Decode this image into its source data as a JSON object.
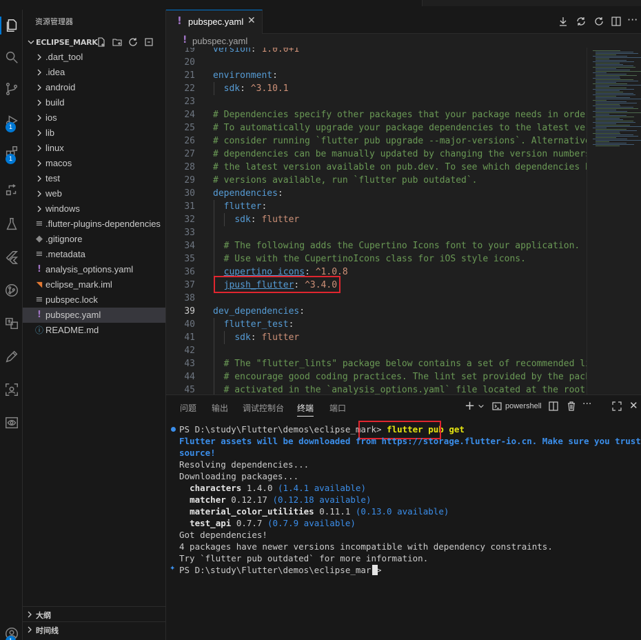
{
  "explorer": {
    "title": "资源管理器",
    "folder": "ECLIPSE_MARK",
    "items": [
      {
        "label": ".dart_tool",
        "kind": "folder"
      },
      {
        "label": ".idea",
        "kind": "folder"
      },
      {
        "label": "android",
        "kind": "folder"
      },
      {
        "label": "build",
        "kind": "folder"
      },
      {
        "label": "ios",
        "kind": "folder"
      },
      {
        "label": "lib",
        "kind": "folder"
      },
      {
        "label": "linux",
        "kind": "folder"
      },
      {
        "label": "macos",
        "kind": "folder"
      },
      {
        "label": "test",
        "kind": "folder"
      },
      {
        "label": "web",
        "kind": "folder"
      },
      {
        "label": "windows",
        "kind": "folder"
      },
      {
        "label": ".flutter-plugins-dependencies",
        "kind": "lines"
      },
      {
        "label": ".gitignore",
        "kind": "git"
      },
      {
        "label": ".metadata",
        "kind": "lines"
      },
      {
        "label": "analysis_options.yaml",
        "kind": "yaml"
      },
      {
        "label": "eclipse_mark.iml",
        "kind": "rss"
      },
      {
        "label": "pubspec.lock",
        "kind": "lines"
      },
      {
        "label": "pubspec.yaml",
        "kind": "yaml"
      },
      {
        "label": "README.md",
        "kind": "info"
      }
    ],
    "outline_label": "大纲",
    "timeline_label": "时间线"
  },
  "activity": {
    "badges": [
      "1",
      "1"
    ]
  },
  "editor": {
    "tab_label": "pubspec.yaml",
    "breadcrumb": "pubspec.yaml",
    "lines": [
      {
        "n": "19",
        "t": [
          [
            "k",
            "version"
          ],
          [
            "p",
            ": "
          ],
          [
            "s",
            "1.0.0+1"
          ]
        ]
      },
      {
        "n": "20",
        "t": []
      },
      {
        "n": "21",
        "t": [
          [
            "k",
            "environment"
          ],
          [
            "p",
            ":"
          ]
        ]
      },
      {
        "n": "22",
        "t": [
          [
            "p",
            "  "
          ],
          [
            "k",
            "sdk"
          ],
          [
            "p",
            ": "
          ],
          [
            "s",
            "^3.10.1"
          ]
        ]
      },
      {
        "n": "23",
        "t": []
      },
      {
        "n": "24",
        "t": [
          [
            "c",
            "# Dependencies specify other packages that your package needs in order to work."
          ]
        ]
      },
      {
        "n": "25",
        "t": [
          [
            "c",
            "# To automatically upgrade your package dependencies to the latest versions"
          ]
        ]
      },
      {
        "n": "26",
        "t": [
          [
            "c",
            "# consider running `flutter pub upgrade --major-versions`. Alternatively,"
          ]
        ]
      },
      {
        "n": "27",
        "t": [
          [
            "c",
            "# dependencies can be manually updated by changing the version numbers below to"
          ]
        ]
      },
      {
        "n": "28",
        "t": [
          [
            "c",
            "# the latest version available on pub.dev. To see which dependencies have newer"
          ]
        ]
      },
      {
        "n": "29",
        "t": [
          [
            "c",
            "# versions available, run `flutter pub outdated`."
          ]
        ]
      },
      {
        "n": "30",
        "t": [
          [
            "k",
            "dependencies"
          ],
          [
            "p",
            ":"
          ]
        ]
      },
      {
        "n": "31",
        "t": [
          [
            "p",
            "  "
          ],
          [
            "k",
            "flutter"
          ],
          [
            "p",
            ":"
          ]
        ]
      },
      {
        "n": "32",
        "t": [
          [
            "p",
            "    "
          ],
          [
            "k",
            "sdk"
          ],
          [
            "p",
            ": "
          ],
          [
            "s",
            "flutter"
          ]
        ]
      },
      {
        "n": "33",
        "t": []
      },
      {
        "n": "34",
        "t": [
          [
            "p",
            "  "
          ],
          [
            "c",
            "# The following adds the Cupertino Icons font to your application."
          ]
        ]
      },
      {
        "n": "35",
        "t": [
          [
            "p",
            "  "
          ],
          [
            "c",
            "# Use with the CupertinoIcons class for iOS style icons."
          ]
        ]
      },
      {
        "n": "36",
        "t": [
          [
            "p",
            "  "
          ],
          [
            "ku",
            "cupertino_icons"
          ],
          [
            "p",
            ": "
          ],
          [
            "s",
            "^1.0.8"
          ]
        ]
      },
      {
        "n": "37",
        "t": [
          [
            "p",
            "  "
          ],
          [
            "ku",
            "jpush_flutter"
          ],
          [
            "p",
            ": "
          ],
          [
            "s",
            "^3.4.0"
          ]
        ]
      },
      {
        "n": "38",
        "t": []
      },
      {
        "n": "39",
        "t": [
          [
            "k",
            "dev_dependencies"
          ],
          [
            "p",
            ":"
          ]
        ]
      },
      {
        "n": "40",
        "t": [
          [
            "p",
            "  "
          ],
          [
            "k",
            "flutter_test"
          ],
          [
            "p",
            ":"
          ]
        ]
      },
      {
        "n": "41",
        "t": [
          [
            "p",
            "    "
          ],
          [
            "k",
            "sdk"
          ],
          [
            "p",
            ": "
          ],
          [
            "s",
            "flutter"
          ]
        ]
      },
      {
        "n": "42",
        "t": []
      },
      {
        "n": "43",
        "t": [
          [
            "p",
            "  "
          ],
          [
            "c",
            "# The \"flutter_lints\" package below contains a set of recommended lints to"
          ]
        ]
      },
      {
        "n": "44",
        "t": [
          [
            "p",
            "  "
          ],
          [
            "c",
            "# encourage good coding practices. The lint set provided by the package is"
          ]
        ]
      },
      {
        "n": "45",
        "t": [
          [
            "p",
            "  "
          ],
          [
            "c",
            "# activated in the `analysis_options.yaml` file located at the root of your"
          ]
        ]
      }
    ],
    "current_line": "39"
  },
  "panel": {
    "tabs": [
      "问题",
      "输出",
      "调试控制台",
      "终端",
      "端口"
    ],
    "active_tab": "终端",
    "shell_label": "powershell",
    "terminal": {
      "prompt1": "PS D:\\study\\Flutter\\demos\\eclipse_mark> ",
      "command": "flutter pub get",
      "assets_line1": "Flutter assets will be downloaded from https://storage.flutter-io.cn. Make sure you trust this",
      "assets_line2": "source!",
      "resolving": "Resolving dependencies...",
      "downloading": "Downloading packages...",
      "packages": [
        {
          "name": "characters",
          "ver": "1.4.0",
          "avail": "(1.4.1 available)"
        },
        {
          "name": "matcher",
          "ver": "0.12.17",
          "avail": "(0.12.18 available)"
        },
        {
          "name": "material_color_utilities",
          "ver": "0.11.1",
          "avail": "(0.13.0 available)"
        },
        {
          "name": "test_api",
          "ver": "0.7.7",
          "avail": "(0.7.9 available)"
        }
      ],
      "got": "Got dependencies!",
      "newer": "4 packages have newer versions incompatible with dependency constraints.",
      "try": "Try `flutter pub outdated` for more information.",
      "prompt2": "PS D:\\study\\Flutter\\demos\\eclipse_mark> "
    }
  },
  "colors": {
    "accent": "#0078d4",
    "highlight_box": "#e0262f",
    "yaml_icon": "#a074c4"
  }
}
